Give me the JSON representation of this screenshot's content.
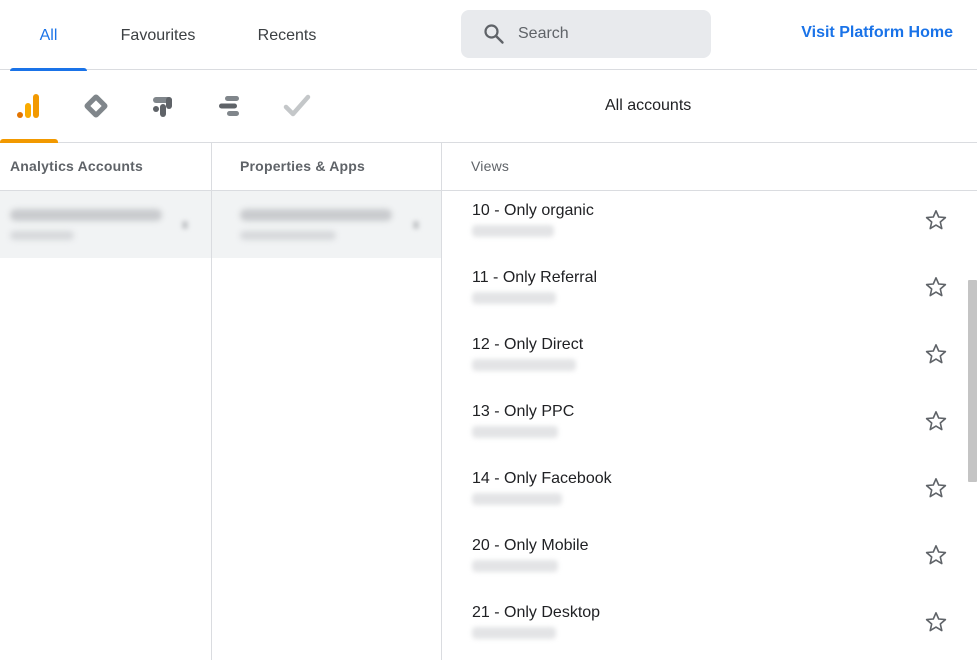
{
  "tabs": [
    {
      "label": "All",
      "active": true
    },
    {
      "label": "Favourites",
      "active": false
    },
    {
      "label": "Recents",
      "active": false
    }
  ],
  "search": {
    "placeholder": "Search",
    "icon": "search-icon"
  },
  "home_link": "Visit Platform Home",
  "products": [
    {
      "name": "analytics-icon",
      "active": true,
      "color": "#f29900"
    },
    {
      "name": "tag-manager-icon",
      "active": false,
      "color": "#5f6368"
    },
    {
      "name": "optimize-icon",
      "active": false,
      "color": "#5f6368"
    },
    {
      "name": "data-studio-icon",
      "active": false,
      "color": "#5f6368"
    },
    {
      "name": "surveys-icon",
      "active": false,
      "color": "#bdc1c6"
    }
  ],
  "scope_label": "All accounts",
  "columns": {
    "accounts": "Analytics Accounts",
    "properties": "Properties & Apps",
    "views": "Views"
  },
  "views": [
    {
      "name": "10 - Only organic"
    },
    {
      "name": "11 - Only Referral"
    },
    {
      "name": "12 - Only Direct"
    },
    {
      "name": "13 - Only PPC"
    },
    {
      "name": "14 - Only Facebook"
    },
    {
      "name": "20 - Only Mobile"
    },
    {
      "name": "21 - Only Desktop"
    }
  ],
  "colors": {
    "accent": "#1a73e8",
    "analytics": "#f29900",
    "divider": "#dadce0"
  }
}
